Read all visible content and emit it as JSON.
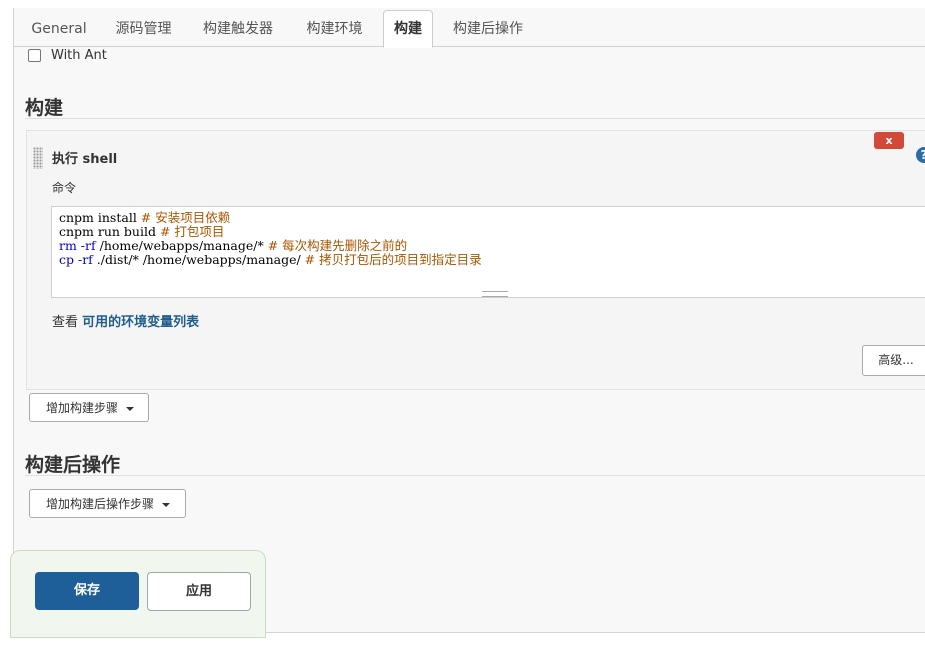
{
  "tabs": [
    {
      "label": "General"
    },
    {
      "label": "源码管理"
    },
    {
      "label": "构建触发器"
    },
    {
      "label": "构建环境"
    },
    {
      "label": "构建",
      "active": true
    },
    {
      "label": "构建后操作"
    }
  ],
  "build_env": {
    "with_ant_label": "With Ant",
    "with_ant_checked": false
  },
  "build": {
    "title": "构建",
    "step": {
      "title": "执行 shell",
      "delete_label": "x",
      "command_label": "命令",
      "command_lines": [
        {
          "cmd": "cnpm install ",
          "comment": "# 安装项目依赖"
        },
        {
          "cmd": "cnpm run build ",
          "comment": "# 打包项目"
        },
        {
          "kw": "rm -rf",
          "cmd": " /home/webapps/manage/* ",
          "comment": "# 每次构建先删除之前的"
        },
        {
          "kw": "cp -rf",
          "cmd": " ./dist/* /home/webapps/manage/ ",
          "comment": "# 拷贝打包后的项目到指定目录"
        }
      ],
      "env_prefix": "查看",
      "env_link": "可用的环境变量列表",
      "advanced_label": "高级..."
    },
    "add_step_label": "增加构建步骤"
  },
  "post_build": {
    "title": "构建后操作",
    "add_step_label": "增加构建后操作步骤"
  },
  "actions": {
    "save_label": "保存",
    "apply_label": "应用"
  },
  "colors": {
    "primary": "#1f5f99",
    "delete": "#d24939",
    "link": "#205e8d",
    "comment": "#aa5500"
  }
}
